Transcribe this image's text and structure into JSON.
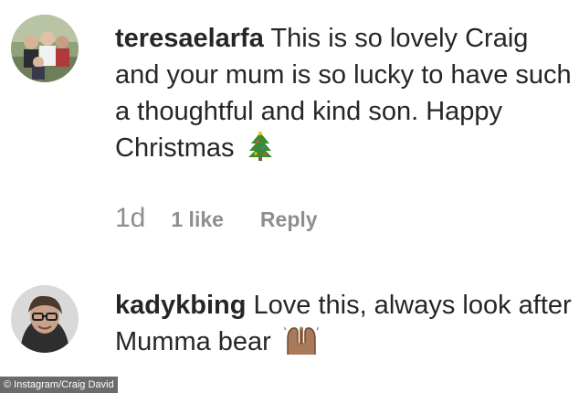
{
  "comments": [
    {
      "username": "teresaelarfa",
      "text": "This is so lovely Craig and your mum is so lucky to have such a thoughtful and kind son. Happy Christmas",
      "emoji": "christmas-tree-icon",
      "time": "1d",
      "likes": "1 like",
      "reply": "Reply"
    },
    {
      "username": "kadykbing",
      "text": "Love this, always look after Mumma bear",
      "emoji": "raised-hands-icon"
    }
  ],
  "credit": "© Instagram/Craig David",
  "colors": {
    "text": "#262626",
    "meta": "#8e8e8e",
    "credit_bg": "#6b6b6b"
  }
}
